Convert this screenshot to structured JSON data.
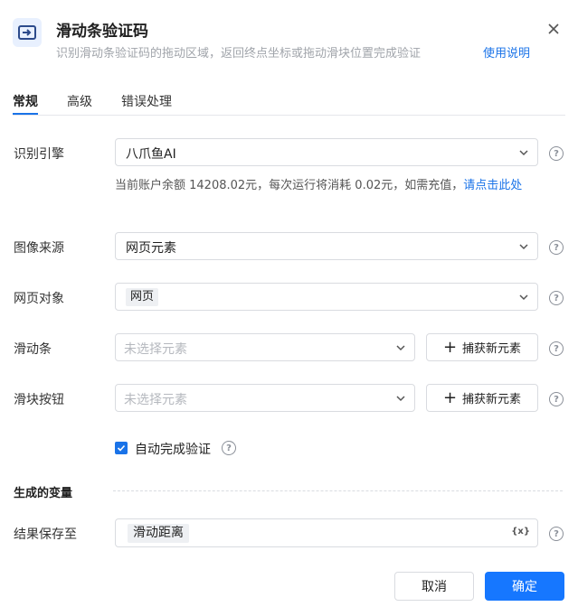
{
  "header": {
    "icon": "slider-captcha-icon",
    "title": "滑动条验证码",
    "subtitle": "识别滑动条验证码的拖动区域，返回终点坐标或拖动滑块位置完成验证",
    "help_link": "使用说明"
  },
  "tabs": [
    "常规",
    "高级",
    "错误处理"
  ],
  "active_tab": "常规",
  "form": {
    "engine": {
      "label": "识别引擎",
      "value": "八爪鱼AI"
    },
    "balance": {
      "text": "当前账户余额 14208.02元，每次运行将消耗 0.02元，如需充值，",
      "link": "请点击此处"
    },
    "image_source": {
      "label": "图像来源",
      "value": "网页元素"
    },
    "web_object": {
      "label": "网页对象",
      "value": "网页"
    },
    "slider_bar": {
      "label": "滑动条",
      "placeholder": "未选择元素",
      "capture_label": "捕获新元素"
    },
    "slider_button": {
      "label": "滑块按钮",
      "placeholder": "未选择元素",
      "capture_label": "捕获新元素"
    },
    "auto_verify": {
      "label": "自动完成验证",
      "checked": true
    }
  },
  "variables": {
    "section_title": "生成的变量",
    "save_to": {
      "label": "结果保存至",
      "value": "滑动距离",
      "var_icon_text": "{x}"
    }
  },
  "footer": {
    "cancel": "取消",
    "ok": "确定"
  },
  "colors": {
    "accent": "#1677ff",
    "link": "#1a73e8"
  }
}
